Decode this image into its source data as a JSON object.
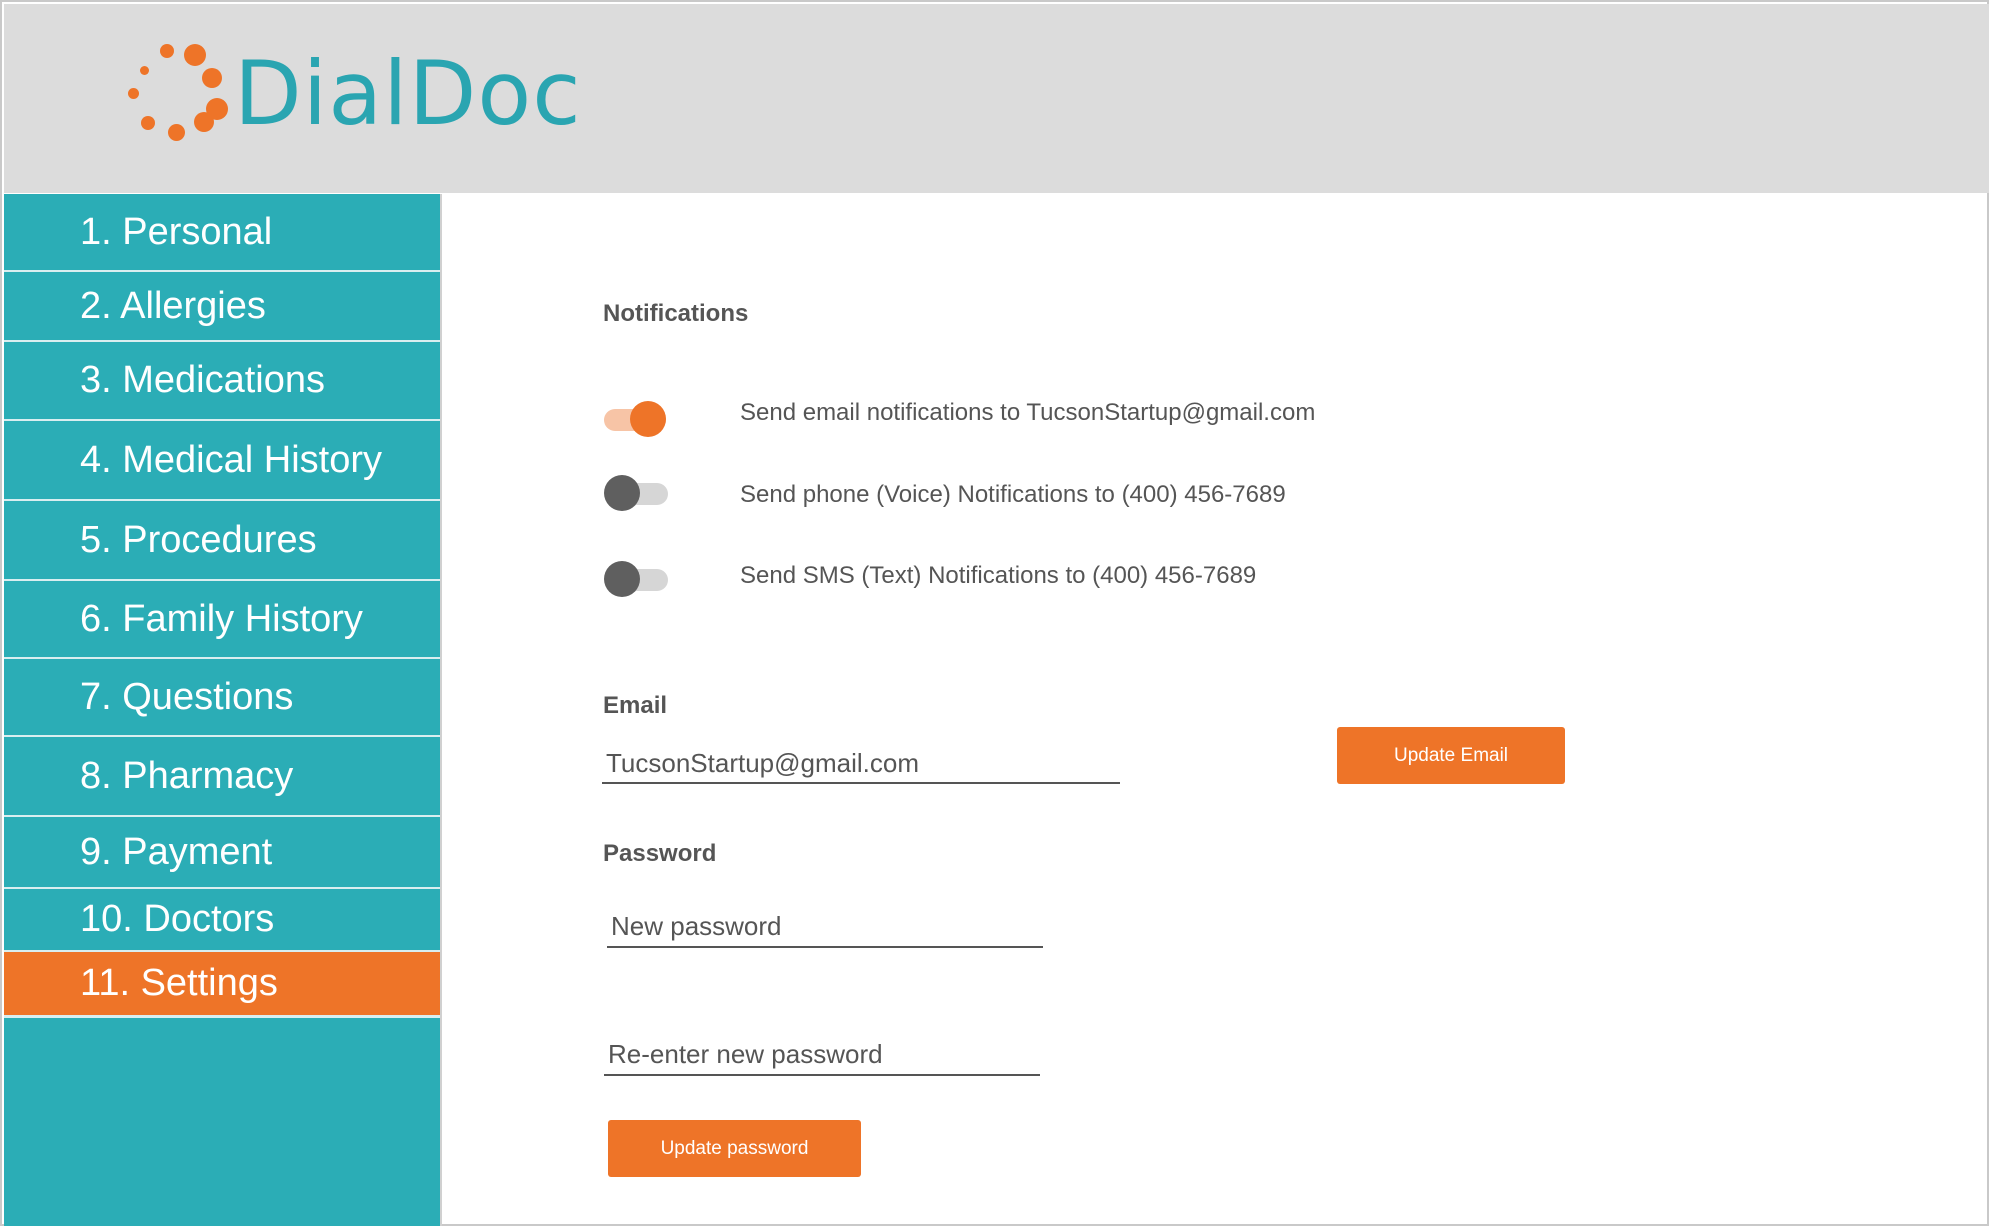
{
  "app": {
    "logo_text": "DialDoc",
    "brand_color": "#2aa5b1",
    "accent_color": "#ee7428"
  },
  "sidebar": {
    "items": [
      {
        "label": "1. Personal",
        "active": false
      },
      {
        "label": "2. Allergies",
        "active": false
      },
      {
        "label": "3. Medications",
        "active": false
      },
      {
        "label": "4. Medical History",
        "active": false
      },
      {
        "label": "5. Procedures",
        "active": false
      },
      {
        "label": "6. Family History",
        "active": false
      },
      {
        "label": "7. Questions",
        "active": false
      },
      {
        "label": "8. Pharmacy",
        "active": false
      },
      {
        "label": "9. Payment",
        "active": false
      },
      {
        "label": "10. Doctors",
        "active": false
      },
      {
        "label": "11. Settings",
        "active": true
      }
    ]
  },
  "notifications": {
    "title": "Notifications",
    "items": [
      {
        "label": "Send email notifications to TucsonStartup@gmail.com",
        "enabled": true
      },
      {
        "label": "Send phone (Voice) Notifications to (400) 456-7689",
        "enabled": false
      },
      {
        "label": "Send SMS (Text) Notifications to (400) 456-7689",
        "enabled": false
      }
    ]
  },
  "email": {
    "title": "Email",
    "value": "TucsonStartup@gmail.com",
    "update_label": "Update Email"
  },
  "password": {
    "title": "Password",
    "new_placeholder": "New password",
    "confirm_placeholder": "Re-enter new password",
    "update_label": "Update password"
  }
}
